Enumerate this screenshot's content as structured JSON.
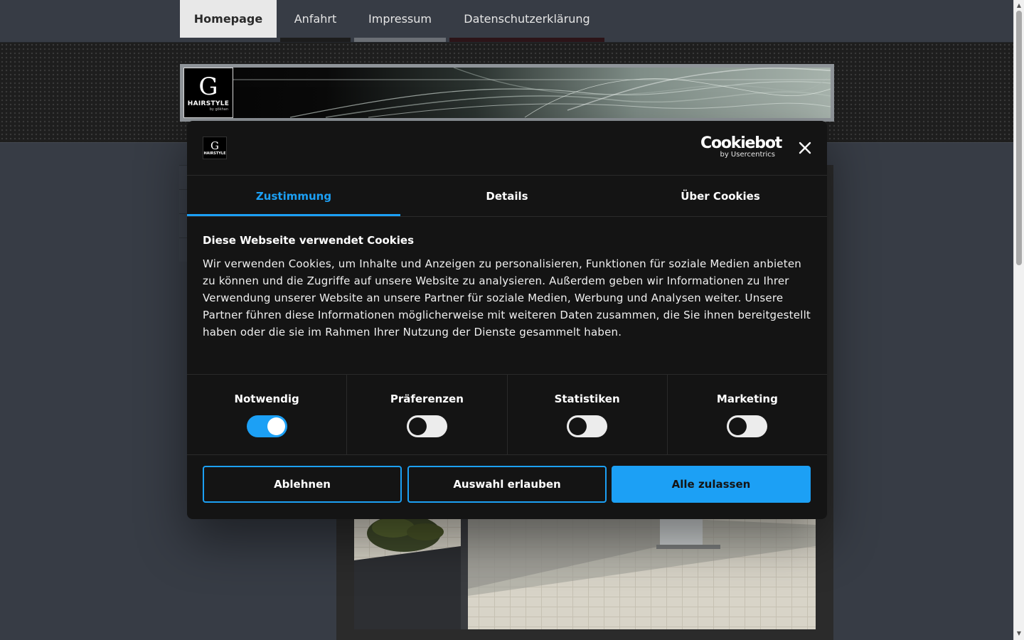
{
  "nav": {
    "tabs": [
      {
        "label": "Homepage",
        "active": true
      },
      {
        "label": "Anfahrt",
        "accent": "#1c1c1c"
      },
      {
        "label": "Impressum",
        "accent": "#6b6f75"
      },
      {
        "label": "Datenschutzerklärung",
        "accent": "#2c1418"
      }
    ]
  },
  "site_logo": {
    "letter": "G",
    "word": "HAIRSTYLE",
    "sub": "by gökhan"
  },
  "cookie_dialog": {
    "brand": {
      "name": "Cookiebot",
      "sub": "by Usercentrics"
    },
    "tabs": [
      {
        "label": "Zustimmung",
        "active": true
      },
      {
        "label": "Details",
        "active": false
      },
      {
        "label": "Über Cookies",
        "active": false
      }
    ],
    "heading": "Diese Webseite verwendet Cookies",
    "text": "Wir verwenden Cookies, um Inhalte und Anzeigen zu personalisieren, Funktionen für soziale Medien anbieten zu können und die Zugriffe auf unsere Website zu analysieren. Außerdem geben wir Informationen zu Ihrer Verwendung unserer Website an unsere Partner für soziale Medien, Werbung und Analysen weiter. Unsere Partner führen diese Informationen möglicherweise mit weiteren Daten zusammen, die Sie ihnen bereitgestellt haben oder die sie im Rahmen Ihrer Nutzung der Dienste gesammelt haben.",
    "toggles": [
      {
        "label": "Notwendig",
        "on": true
      },
      {
        "label": "Präferenzen",
        "on": false
      },
      {
        "label": "Statistiken",
        "on": false
      },
      {
        "label": "Marketing",
        "on": false
      }
    ],
    "buttons": {
      "reject": "Ablehnen",
      "allow_selection": "Auswahl erlauben",
      "allow_all": "Alle zulassen"
    }
  },
  "colors": {
    "accent": "#1ca0f5",
    "dialog_bg": "#141414",
    "page_bg": "#373c45"
  }
}
